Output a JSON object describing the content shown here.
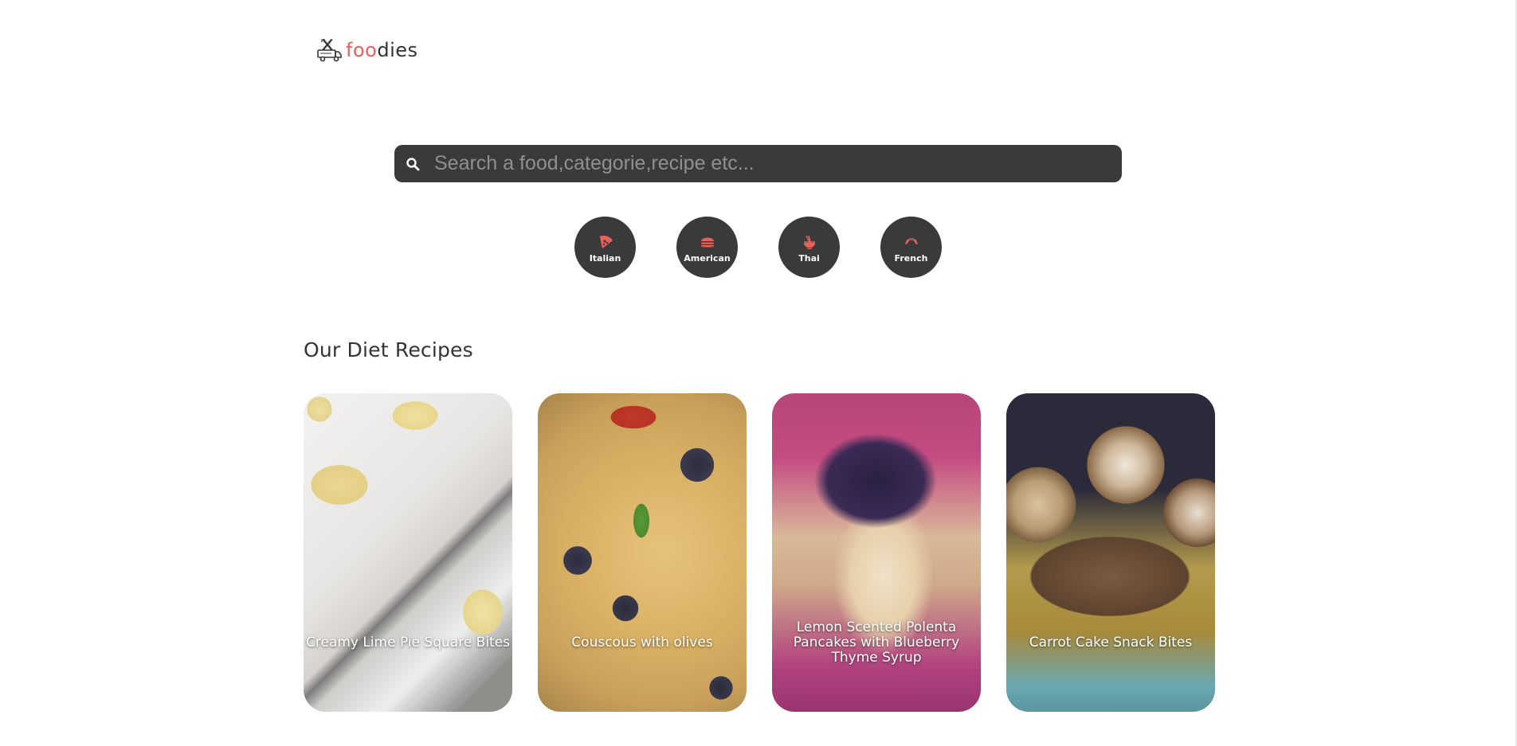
{
  "logo": {
    "icon": "food-truck-icon",
    "text_accent": "foo",
    "text_rest": "dies",
    "accent_color": "#e8605a"
  },
  "search": {
    "icon": "search-icon",
    "placeholder": "Search a food,categorie,recipe etc..."
  },
  "categories": [
    {
      "label": "Italian",
      "icon": "pizza-icon"
    },
    {
      "label": "American",
      "icon": "burger-icon"
    },
    {
      "label": "Thai",
      "icon": "noodles-bowl-icon"
    },
    {
      "label": "French",
      "icon": "croissant-icon"
    }
  ],
  "section": {
    "title": "Our Diet Recipes"
  },
  "recipes": [
    {
      "title": "Creamy Lime Pie Square Bites"
    },
    {
      "title": "Couscous with olives"
    },
    {
      "title": "Lemon Scented Polenta Pancakes with Blueberry Thyme Syrup"
    },
    {
      "title": "Carrot Cake Snack Bites"
    }
  ],
  "colors": {
    "dark_surface": "#3a3a3a",
    "accent": "#e8605a"
  }
}
